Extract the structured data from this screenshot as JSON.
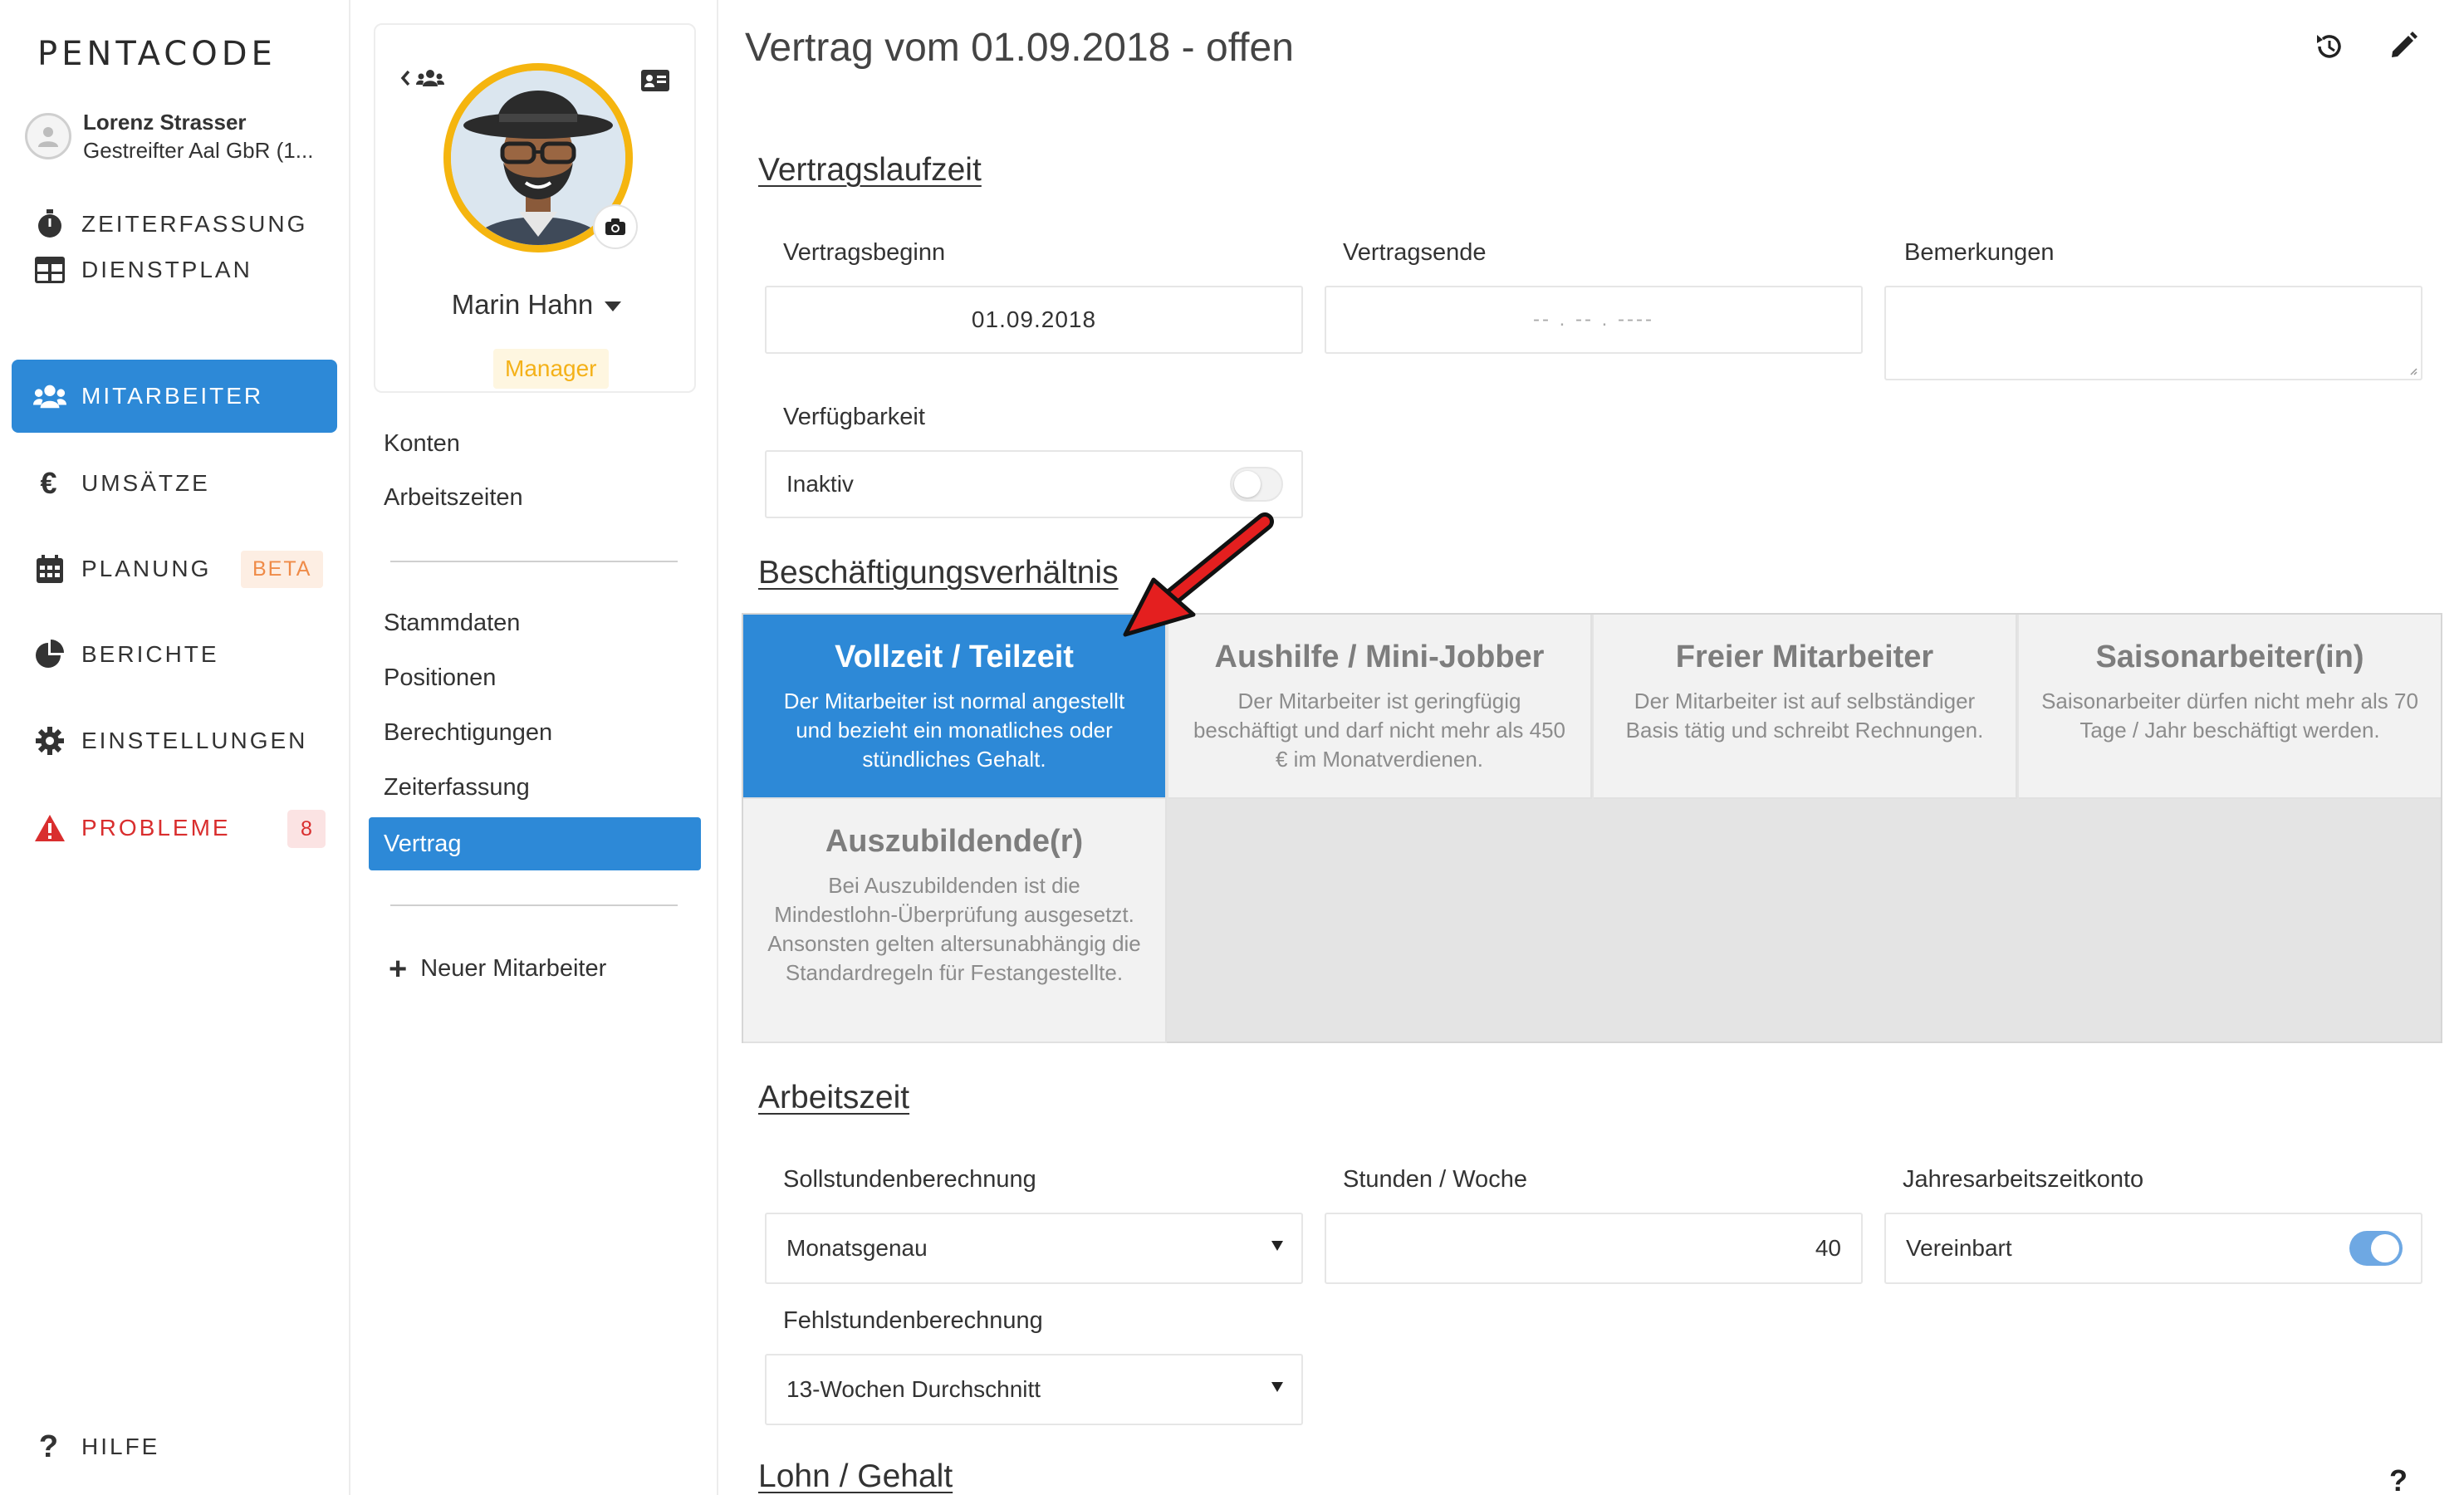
{
  "app": {
    "logo": "PENTACODE"
  },
  "user": {
    "name": "Lorenz Strasser",
    "company": "Gestreifter Aal GbR (1..."
  },
  "nav": {
    "items": [
      {
        "label": "ZEITERFASSUNG",
        "icon": "stopwatch-icon"
      },
      {
        "label": "DIENSTPLAN",
        "icon": "table-icon"
      },
      {
        "label": "MITARBEITER",
        "icon": "users-icon",
        "active": true
      },
      {
        "label": "UMSÄTZE",
        "icon": "euro-icon"
      },
      {
        "label": "PLANUNG",
        "icon": "calendar-icon",
        "badge": "BETA"
      },
      {
        "label": "BERICHTE",
        "icon": "pie-chart-icon"
      },
      {
        "label": "EINSTELLUNGEN",
        "icon": "gear-icon"
      },
      {
        "label": "PROBLEME",
        "icon": "warning-icon",
        "badge": "8"
      }
    ],
    "help": "HILFE"
  },
  "employee": {
    "name": "Marin Hahn",
    "role": "Manager",
    "links_top": [
      "Konten",
      "Arbeitszeiten"
    ],
    "links_mid": [
      "Stammdaten",
      "Positionen",
      "Berechtigungen",
      "Zeiterfassung",
      "Vertrag"
    ],
    "active_link": "Vertrag",
    "new_employee": "Neuer Mitarbeiter"
  },
  "contract": {
    "title": "Vertrag vom 01.09.2018 - offen",
    "sections": {
      "laufzeit": "Vertragslaufzeit",
      "beschaeftigung": "Beschäftigungsverhältnis",
      "arbeitszeit": "Arbeitszeit",
      "lohn": "Lohn / Gehalt"
    },
    "fields": {
      "vertragsbeginn_label": "Vertragsbeginn",
      "vertragsbeginn_value": "01.09.2018",
      "vertragsende_label": "Vertragsende",
      "vertragsende_placeholder": "-- . -- . ----",
      "bemerkungen_label": "Bemerkungen",
      "verfuegbarkeit_label": "Verfügbarkeit",
      "verfuegbarkeit_value": "Inaktiv",
      "verfuegbarkeit_on": false,
      "sollstunden_label": "Sollstundenberechnung",
      "sollstunden_value": "Monatsgenau",
      "stunden_label": "Stunden / Woche",
      "stunden_value": "40",
      "jahresarbeitszeit_label": "Jahresarbeitszeitkonto",
      "jahresarbeitszeit_value": "Vereinbart",
      "jahresarbeitszeit_on": true,
      "fehlstunden_label": "Fehlstundenberechnung",
      "fehlstunden_value": "13-Wochen Durchschnitt"
    },
    "employment_types": [
      {
        "title": "Vollzeit / Teilzeit",
        "desc": "Der Mitarbeiter ist normal angestellt und bezieht ein monatliches oder stündliches Gehalt.",
        "selected": true
      },
      {
        "title": "Aushilfe / Mini-Jobber",
        "desc": "Der Mitarbeiter ist geringfügig beschäftigt und darf nicht mehr als 450 € im Monatverdienen.",
        "selected": false
      },
      {
        "title": "Freier Mitarbeiter",
        "desc": "Der Mitarbeiter ist auf selbständiger Basis tätig und schreibt Rechnungen.",
        "selected": false
      },
      {
        "title": "Saisonarbeiter(in)",
        "desc": "Saisonarbeiter dürfen nicht mehr als 70 Tage / Jahr beschäftigt werden.",
        "selected": false
      },
      {
        "title": "Auszubildende(r)",
        "desc": "Bei Auszubildenden ist die Mindestlohn-Überprüfung ausgesetzt. Ansonsten gelten altersunabhängig die Standardregeln für Festangestellte.",
        "selected": false
      }
    ],
    "help_mark": "?"
  },
  "colors": {
    "accent": "#2d89d7",
    "manager_badge": "#f4b118",
    "problem": "#d92e2e",
    "beta": "#ef8b48",
    "arrow": "#e41f1f"
  }
}
